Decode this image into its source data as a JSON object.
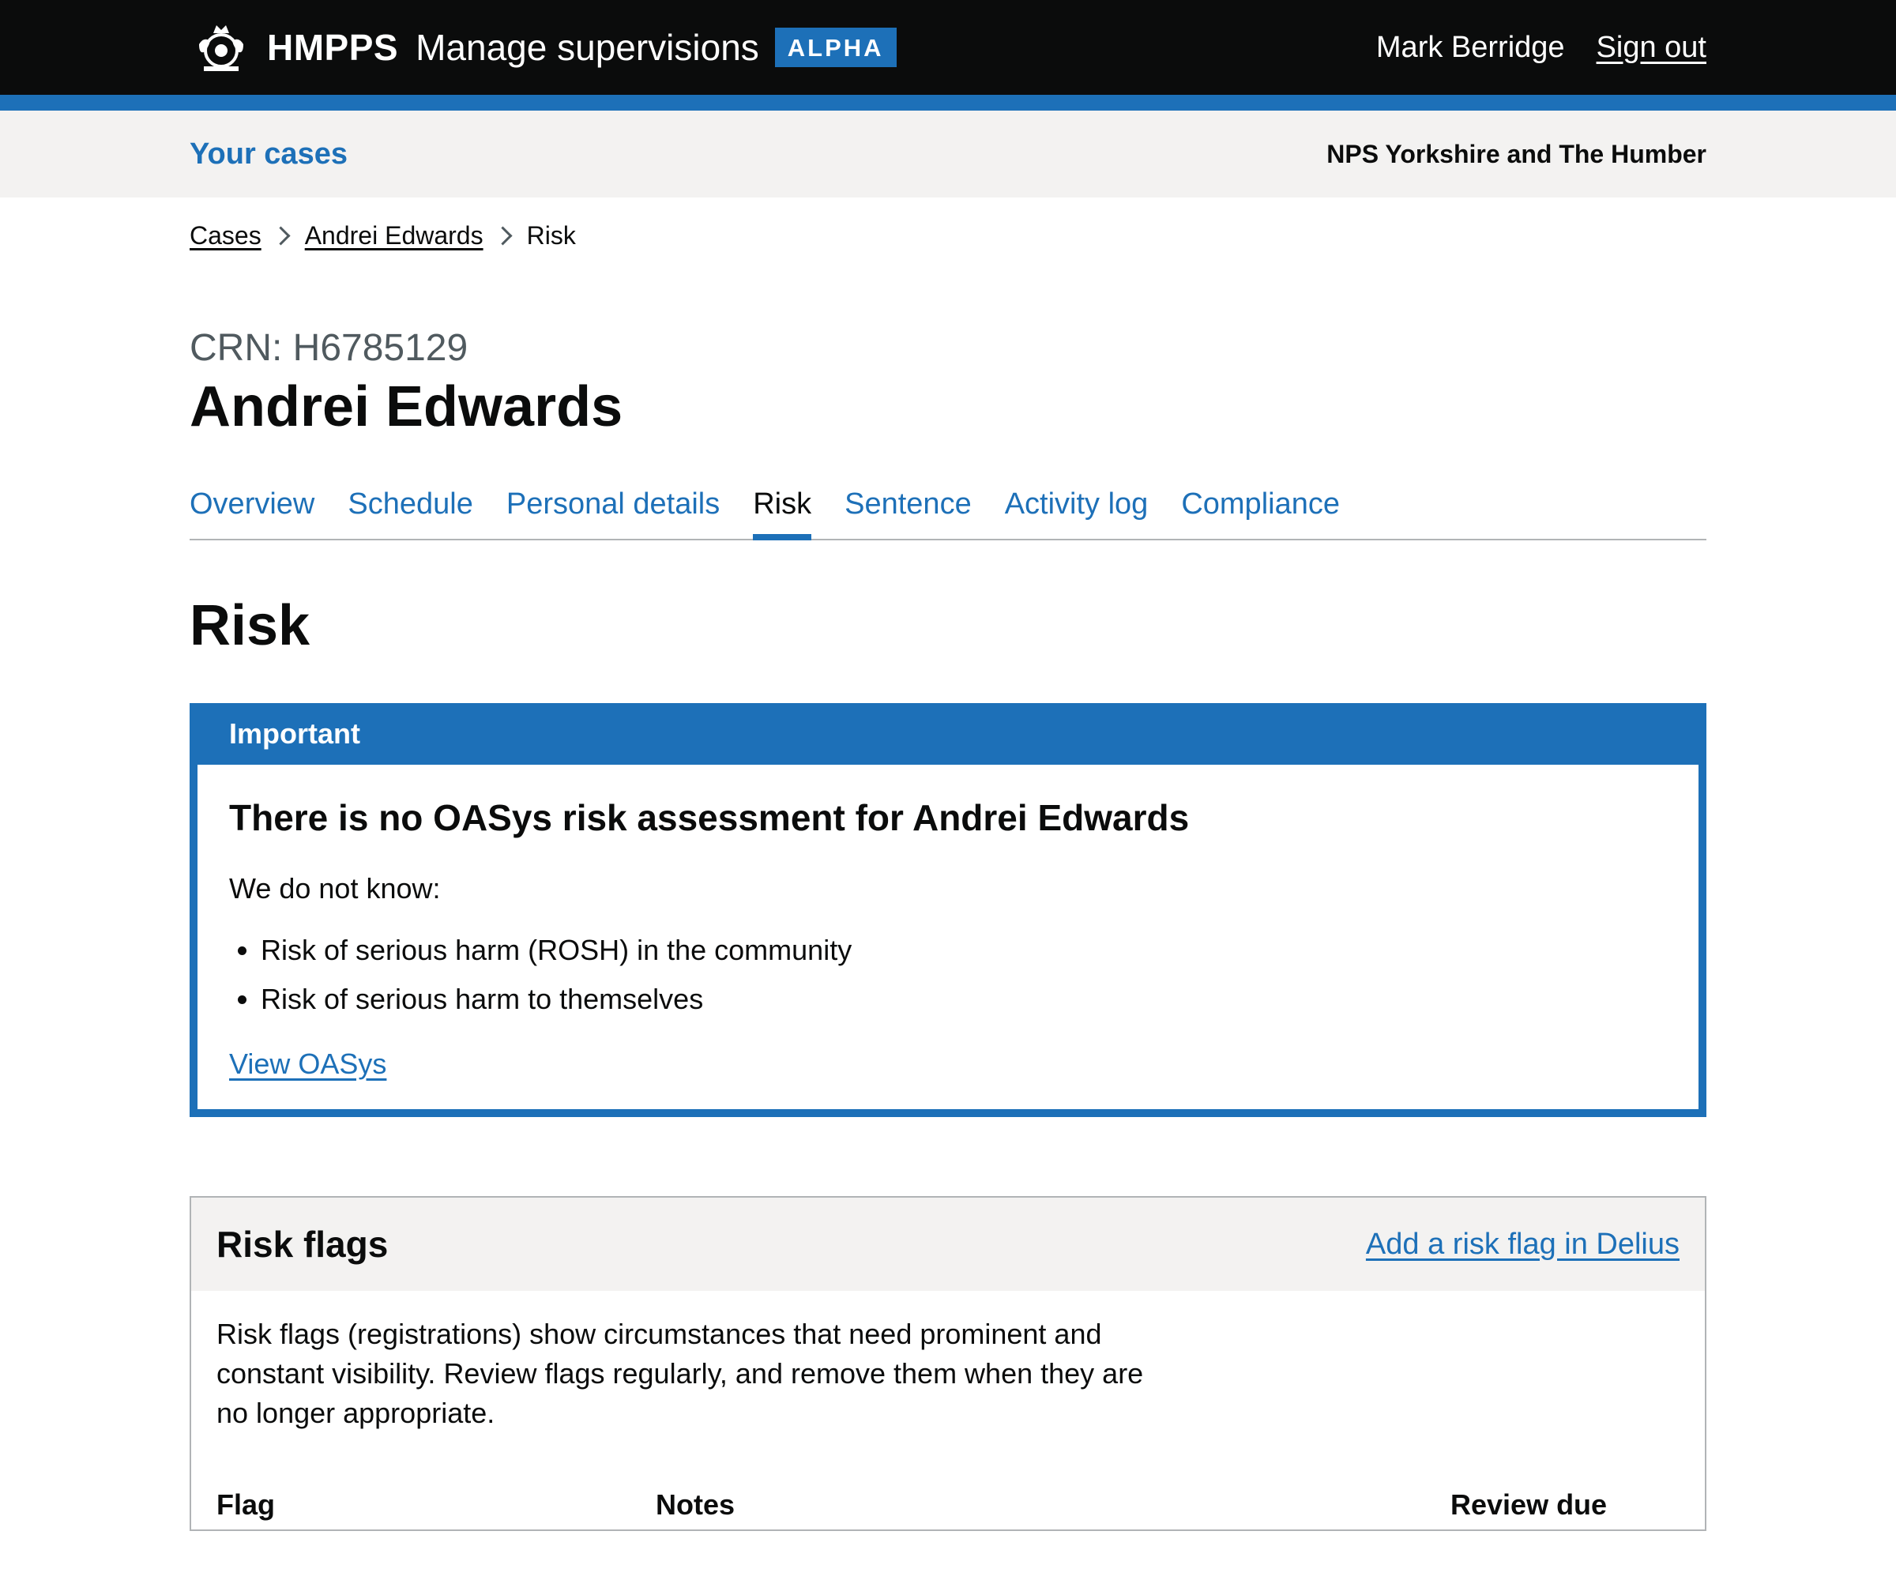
{
  "header": {
    "brand": "HMPPS",
    "service": "Manage supervisions",
    "phase": "ALPHA",
    "user": "Mark Berridge",
    "sign_out": "Sign out"
  },
  "subnav": {
    "your_cases": "Your cases",
    "region": "NPS Yorkshire and The Humber"
  },
  "breadcrumbs": [
    {
      "label": "Cases"
    },
    {
      "label": "Andrei Edwards"
    },
    {
      "label": "Risk"
    }
  ],
  "case": {
    "crn": "CRN: H6785129",
    "name": "Andrei Edwards"
  },
  "tabs": [
    {
      "label": "Overview"
    },
    {
      "label": "Schedule"
    },
    {
      "label": "Personal details"
    },
    {
      "label": "Risk"
    },
    {
      "label": "Sentence"
    },
    {
      "label": "Activity log"
    },
    {
      "label": "Compliance"
    }
  ],
  "active_tab": "Risk",
  "page_title": "Risk",
  "important": {
    "title": "Important",
    "heading": "There is no OASys risk assessment for Andrei Edwards",
    "intro": "We do not know:",
    "items": [
      "Risk of serious harm (ROSH) in the community",
      "Risk of serious harm to themselves"
    ],
    "link": "View OASys"
  },
  "risk_flags": {
    "title": "Risk flags",
    "add_link": "Add a risk flag in Delius",
    "description": "Risk flags (registrations) show circumstances that need prominent and constant visibility. Review flags regularly, and remove them when they are no longer appropriate.",
    "columns": {
      "flag": "Flag",
      "notes": "Notes",
      "review_due": "Review due"
    }
  },
  "colors": {
    "brand_blue": "#1d70b8",
    "header_black": "#0b0c0c",
    "panel_grey": "#f3f2f1"
  }
}
